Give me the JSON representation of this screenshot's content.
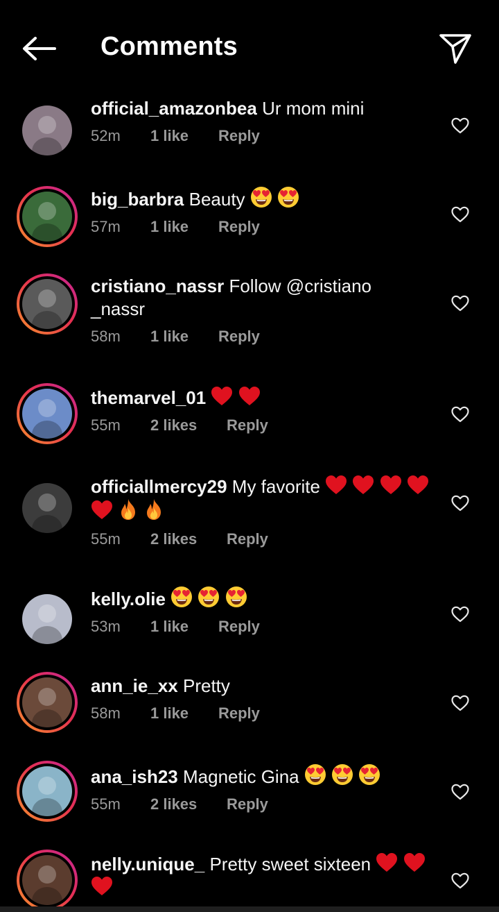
{
  "header": {
    "title": "Comments",
    "back_icon": "arrow-left-icon",
    "share_icon": "paper-plane-icon"
  },
  "comments": [
    {
      "user": "official_amazonbea",
      "text": "Ur mom mini",
      "emojis": [],
      "time": "52m",
      "likes": "1 like",
      "reply": "Reply",
      "ring": false,
      "avatar_color": "#8a7a86"
    },
    {
      "user": "big_barbra",
      "text": "Beauty",
      "emojis": [
        "heart-eyes",
        "heart-eyes"
      ],
      "time": "57m",
      "likes": "1 like",
      "reply": "Reply",
      "ring": true,
      "avatar_color": "#3a6b3a"
    },
    {
      "user": "cristiano_nassr",
      "text": "Follow @cristiano\n_nassr",
      "emojis": [],
      "time": "58m",
      "likes": "1 like",
      "reply": "Reply",
      "ring": true,
      "avatar_color": "#5a5a5a"
    },
    {
      "user": "themarvel_01",
      "text": "",
      "emojis": [
        "red-heart",
        "red-heart"
      ],
      "time": "55m",
      "likes": "2 likes",
      "reply": "Reply",
      "ring": true,
      "avatar_color": "#6c8cc8"
    },
    {
      "user": "officiallmercy29",
      "text": "My favorite",
      "emojis": [
        "red-heart",
        "red-heart",
        "red-heart",
        "red-heart",
        "red-heart",
        "fire",
        "fire"
      ],
      "time": "55m",
      "likes": "2 likes",
      "reply": "Reply",
      "ring": false,
      "avatar_color": "#3c3c3c"
    },
    {
      "user": "kelly.olie",
      "text": "",
      "emojis": [
        "heart-eyes",
        "heart-eyes",
        "heart-eyes"
      ],
      "time": "53m",
      "likes": "1 like",
      "reply": "Reply",
      "ring": false,
      "avatar_color": "#b8bccb"
    },
    {
      "user": "ann_ie_xx",
      "text": "Pretty",
      "emojis": [],
      "time": "58m",
      "likes": "1 like",
      "reply": "Reply",
      "ring": true,
      "avatar_color": "#6b4a3a"
    },
    {
      "user": "ana_ish23",
      "text": "Magnetic Gina",
      "emojis": [
        "heart-eyes",
        "heart-eyes",
        "heart-eyes"
      ],
      "time": "55m",
      "likes": "2 likes",
      "reply": "Reply",
      "ring": true,
      "avatar_color": "#8ab4c8"
    },
    {
      "user": "nelly.unique_",
      "text": "Pretty sweet sixteen",
      "emojis": [
        "red-heart",
        "red-heart",
        "red-heart"
      ],
      "time": "",
      "likes": "",
      "reply": "",
      "ring": true,
      "avatar_color": "#5b3c2e"
    }
  ],
  "colors": {
    "background": "#000000",
    "text": "#f5f5f5",
    "meta": "#9a9a9a",
    "ring_start": "#c3259a",
    "ring_end": "#f7922d"
  }
}
